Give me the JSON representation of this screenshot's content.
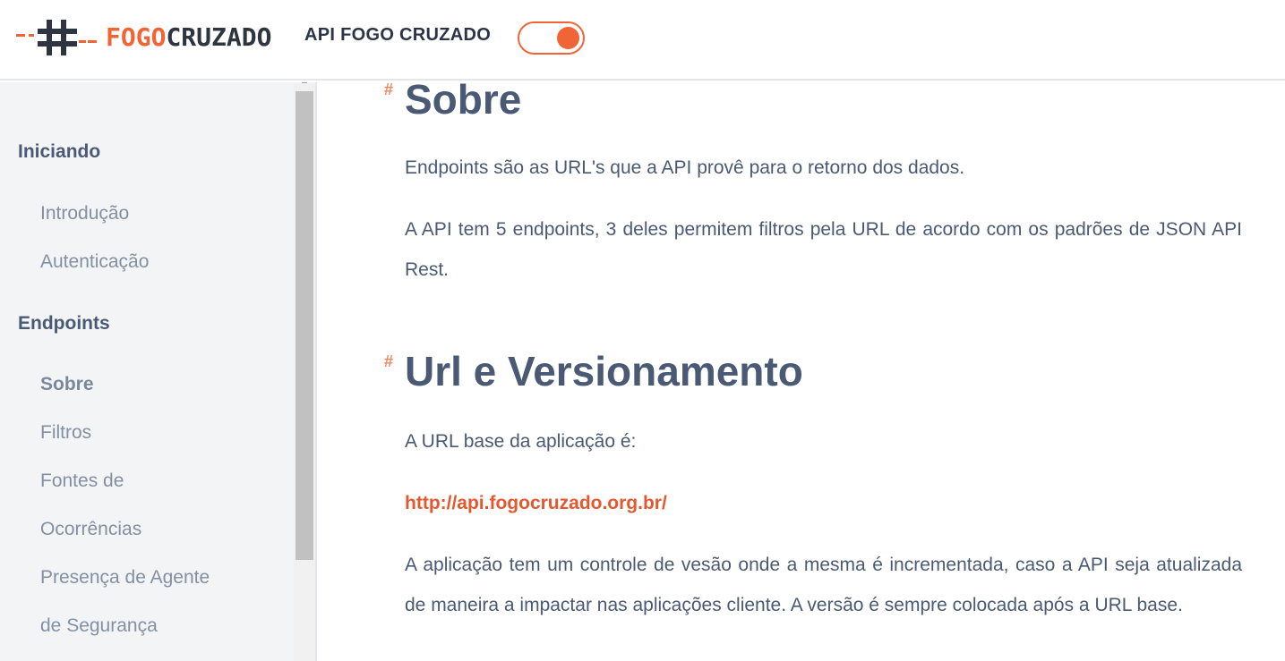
{
  "header": {
    "logo_fogo": "FOGO",
    "logo_cruzado": "CRUZADO",
    "api_title": "API FOGO CRUZADO",
    "toggle_on": true
  },
  "sidebar": {
    "sections": [
      {
        "heading": "Iniciando",
        "items": [
          "Introdução",
          "Autenticação"
        ]
      },
      {
        "heading": "Endpoints",
        "items": [
          "Sobre",
          "Filtros",
          "Fontes de",
          "Ocorrências",
          "Presença de Agente",
          "de Segurança"
        ]
      }
    ],
    "active_item": "Sobre"
  },
  "main": {
    "anchor_symbol": "#",
    "sobre": {
      "title": "Sobre",
      "p1": "Endpoints são as URL's que a API provê para o retorno dos dados.",
      "p2": "A API tem 5 endpoints, 3 deles permitem filtros pela URL de acordo com os padrões de JSON API Rest."
    },
    "versionamento": {
      "title": "Url e Versionamento",
      "p1": "A URL base da aplicação é:",
      "link": "http://api.fogocruzado.org.br/",
      "p2": "A aplicação tem um controle de vesão onde a mesma é incrementada, caso a API seja atualizada de maneira a impactar nas aplicações cliente. A versão é sempre colocada após a URL base."
    }
  },
  "colors": {
    "accent": "#f06536",
    "heading": "#4a5a74",
    "sidebar_bg": "#f3f4f6",
    "link": "#e5582d"
  }
}
